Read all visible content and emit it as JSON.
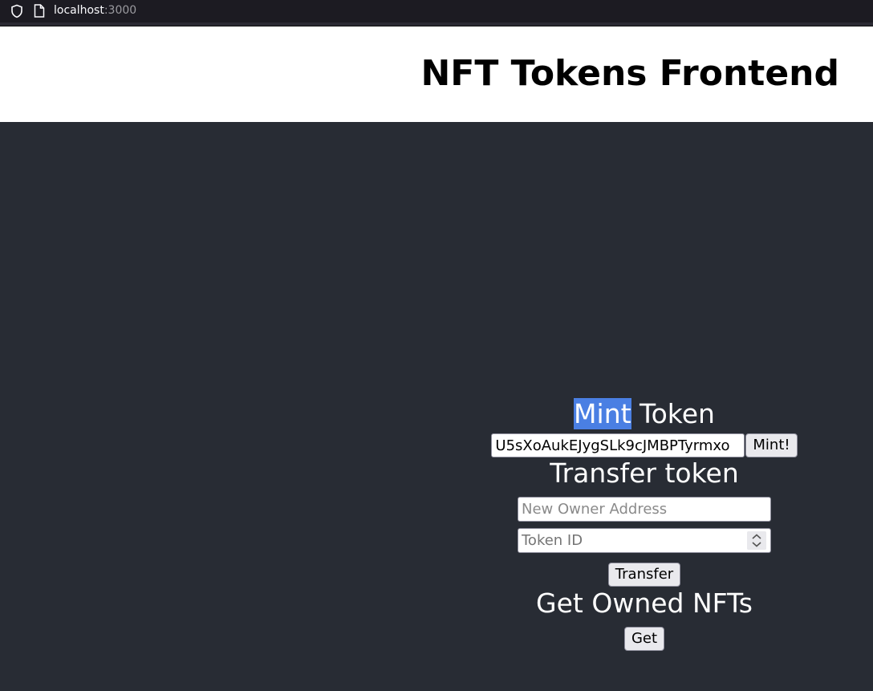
{
  "browser": {
    "url_host": "localhost",
    "url_port": ":3000"
  },
  "header": {
    "title": "NFT Tokens Frontend"
  },
  "mint": {
    "title_highlight": "Mint",
    "title_rest": " Token",
    "input_value": "U5sXoAukEJygSLk9cJMBPTyrmxo",
    "button_label": "Mint!"
  },
  "transfer": {
    "title": "Transfer token",
    "owner_placeholder": "New Owner Address",
    "token_placeholder": "Token ID",
    "button_label": "Transfer"
  },
  "owned": {
    "title": "Get Owned NFTs",
    "button_label": "Get"
  },
  "icons": {
    "shield": "shield-icon",
    "page": "page-icon",
    "spinner": "spinner-arrows-icon"
  },
  "colors": {
    "background": "#282c34",
    "header_bg": "#ffffff",
    "selection_highlight": "#4a7fe3"
  }
}
